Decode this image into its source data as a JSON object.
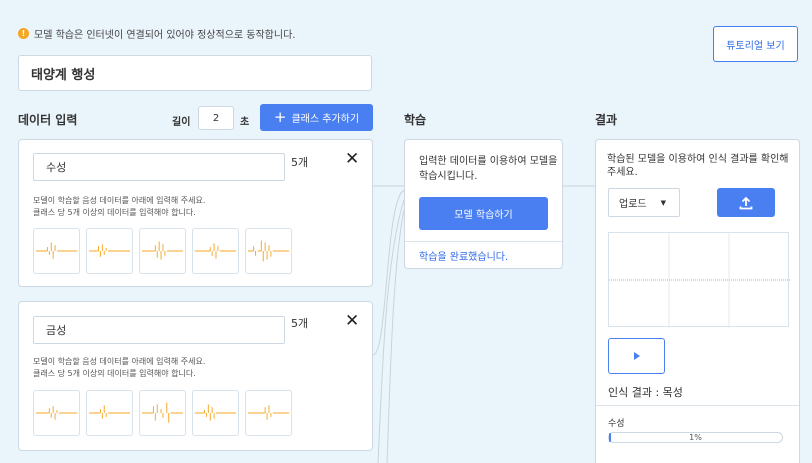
{
  "notice": {
    "icon": "warning-icon",
    "text": "모델 학습은 인터넷이 연결되어 있어야 정상적으로 동작합니다."
  },
  "tutorial_button": "튜토리얼 보기",
  "project_name": "태양계 행성",
  "data_input": {
    "title": "데이터 입력",
    "length_label": "길이",
    "length_value": "2",
    "length_unit": "초",
    "add_class_label": "클래스 추가하기",
    "classes": [
      {
        "name": "수성",
        "count": "5개",
        "desc_line1": "모델이 학습할 음성 데이터를 아래에 입력해 주세요.",
        "desc_line2": "클래스 당 5개 이상의 데이터를 입력해야 합니다."
      },
      {
        "name": "금성",
        "count": "5개",
        "desc_line1": "모델이 학습할 음성 데이터를 아래에 입력해 주세요.",
        "desc_line2": "클래스 당 5개 이상의 데이터를 입력해야 합니다."
      }
    ]
  },
  "learning": {
    "title": "학습",
    "description": "입력한 데이터를 이용하여 모델을 학습시킵니다.",
    "train_button": "모델 학습하기",
    "status": "학습을 완료했습니다."
  },
  "result": {
    "title": "결과",
    "description": "학습된 모델을 이용하여 인식 결과를 확인해주세요.",
    "upload_select": "업로드",
    "result_text": "인식 결과 : 목성",
    "probabilities": [
      {
        "label": "수성",
        "percent_text": "1%",
        "value": 0.01
      }
    ]
  },
  "colors": {
    "accent": "#4a7ff2",
    "background": "#eaf4fb",
    "waveform": "#f5a623"
  }
}
